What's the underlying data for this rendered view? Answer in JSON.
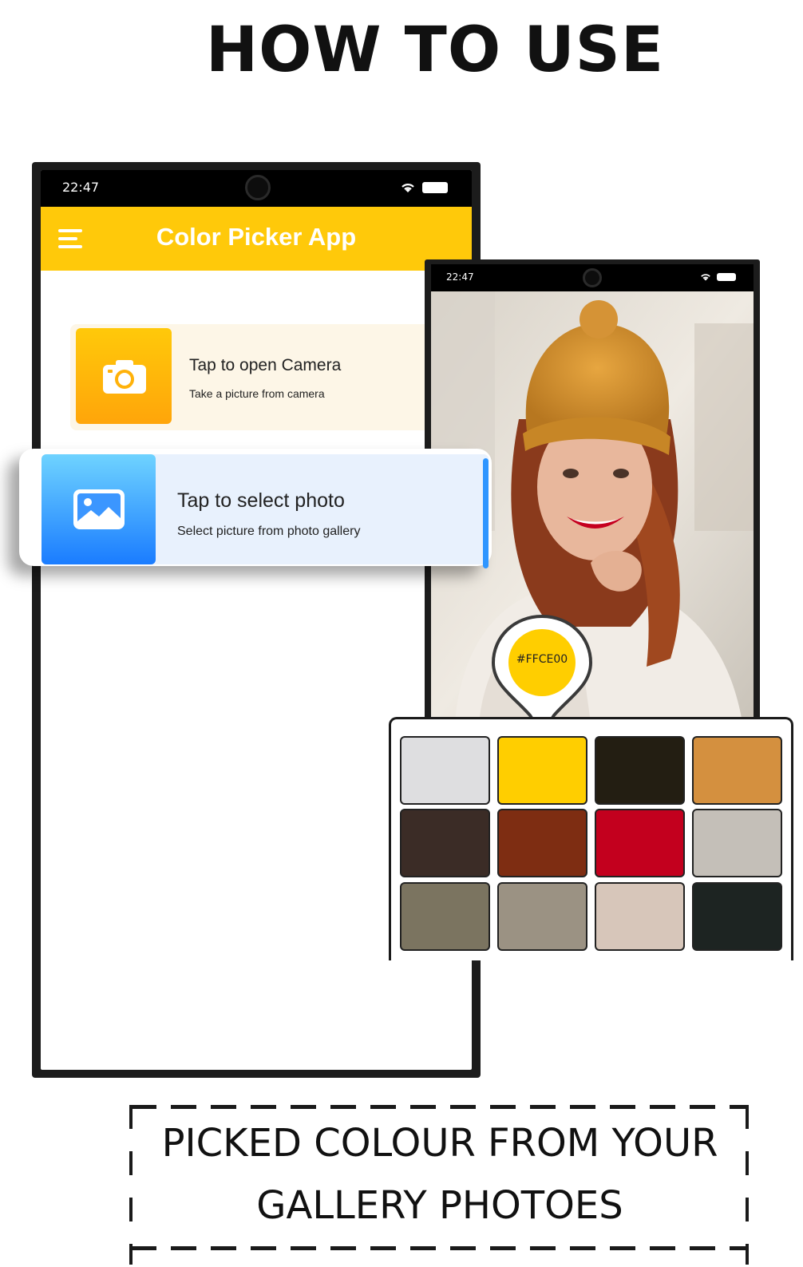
{
  "headline": "HOW TO USE",
  "main_phone": {
    "status_time": "22:47",
    "app_title": "Color Picker App",
    "camera_card": {
      "title": "Tap to open Camera",
      "subtitle": "Take a picture from camera",
      "icon": "camera-icon"
    },
    "gallery_card": {
      "title": "Tap to select photo",
      "subtitle": "Select picture from photo gallery",
      "icon": "image-icon"
    }
  },
  "second_phone": {
    "status_time": "22:47"
  },
  "picker": {
    "hex": "#FFCE00",
    "color": "#FFCE00"
  },
  "palette": {
    "swatches": [
      "#DEDEE0",
      "#FFCE00",
      "#231E12",
      "#D4903F",
      "#3B2C26",
      "#7E2D12",
      "#C3001E",
      "#C4BFB8",
      "#7B7460",
      "#9B9283",
      "#D7C6BA",
      "#1D2422"
    ]
  },
  "caption": {
    "line1": "PICKED COLOUR FROM YOUR",
    "line2": "GALLERY PHOTOES"
  },
  "colors": {
    "accent": "#FFC90A",
    "gallery_blue": "#1A7CFF"
  }
}
